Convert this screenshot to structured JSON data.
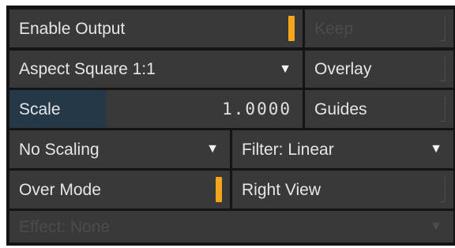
{
  "row1": {
    "enable_output": "Enable Output",
    "enable_output_on": true,
    "keep": "Keep",
    "keep_disabled": true
  },
  "row2": {
    "aspect": "Aspect Square 1:1",
    "overlay": "Overlay",
    "overlay_on": false
  },
  "row3": {
    "scale_label": "Scale",
    "scale_value": "1.0000",
    "scale_fraction": 0.33,
    "guides": "Guides",
    "guides_on": false
  },
  "row4": {
    "scaling": "No Scaling",
    "filter": "Filter: Linear"
  },
  "row5": {
    "over_mode": "Over Mode",
    "over_mode_on": true,
    "right_view": "Right View",
    "right_view_on": false
  },
  "row6": {
    "effect": "Effect: None",
    "effect_disabled": true
  },
  "icons": {
    "dropdown": "triangle-down-icon",
    "toggle": "toggle-indicator-icon"
  },
  "colors": {
    "toggle_on": "#f4a51c",
    "scale_fill": "#243848",
    "cell_bg": "#393939",
    "panel_bg": "#141414"
  }
}
